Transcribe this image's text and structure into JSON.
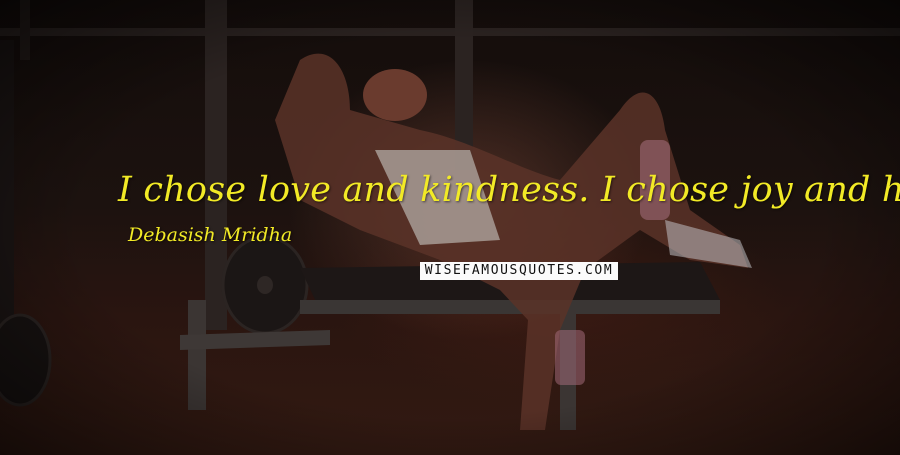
{
  "quote": {
    "text": "I chose love and kindness. I chose joy and happiness.",
    "author": "Debasish Mridha",
    "color": "#f2ea26"
  },
  "watermark": {
    "text": "WISEFAMOUSQUOTES.COM"
  }
}
